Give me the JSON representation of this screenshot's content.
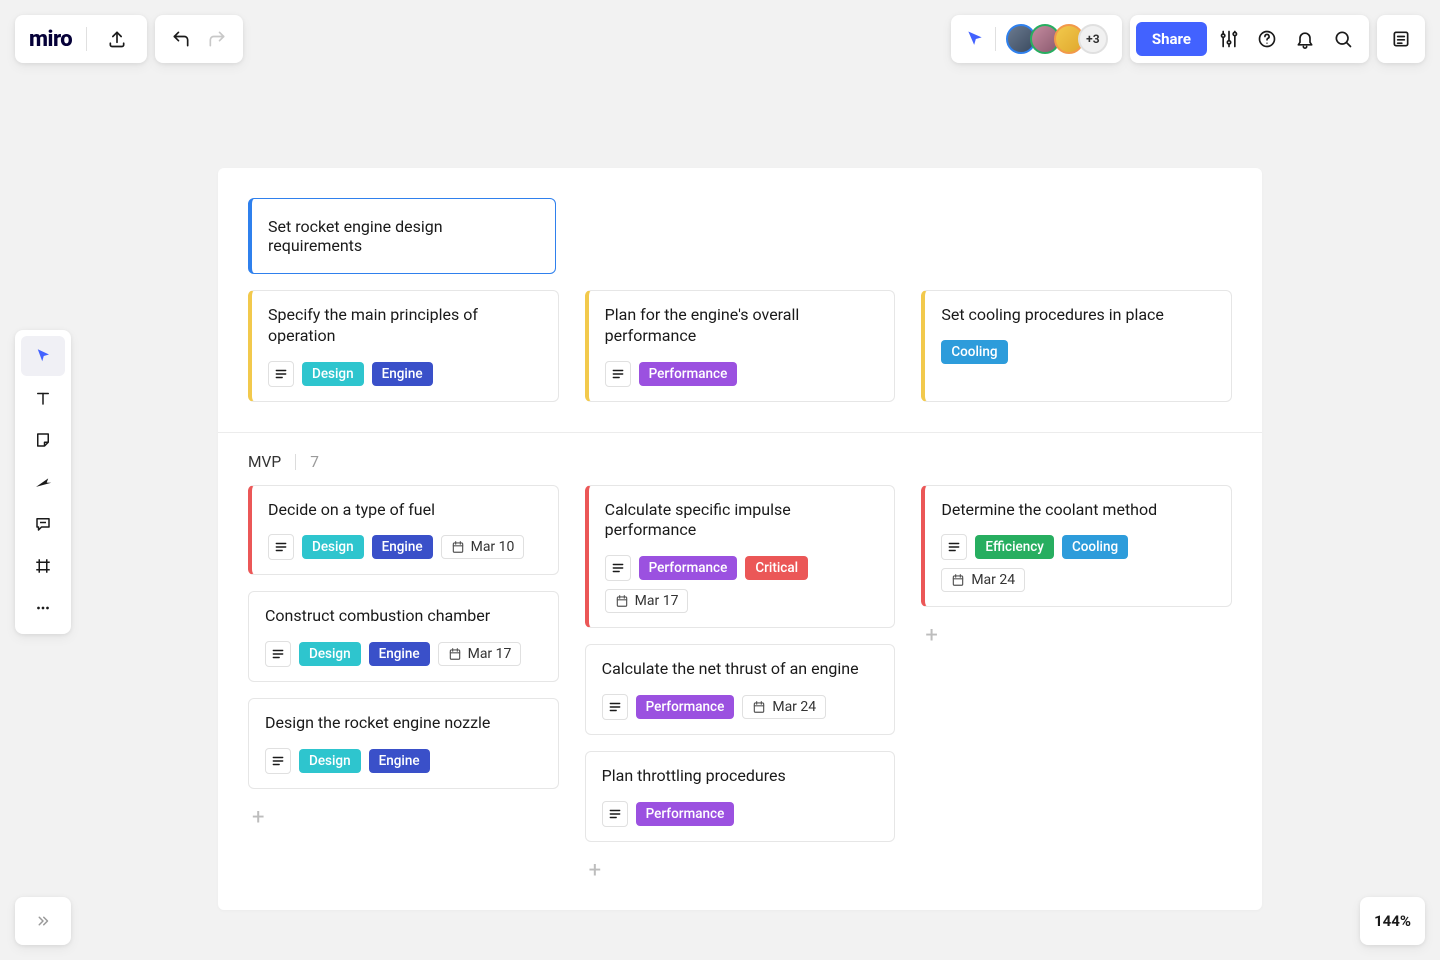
{
  "app": {
    "name": "miro"
  },
  "topbar": {
    "share_label": "Share",
    "more_avatars": "+3"
  },
  "zoom": "144%",
  "section_top": {
    "header_card": "Set rocket engine design requirements",
    "cards": [
      {
        "title": "Specify the main principles of operation",
        "tags": [
          "Design",
          "Engine"
        ],
        "has_desc": true
      },
      {
        "title": "Plan for the engine's overall performance",
        "tags": [
          "Performance"
        ],
        "has_desc": true
      },
      {
        "title": "Set cooling procedures in place",
        "tags": [
          "Cooling"
        ],
        "has_desc": false
      }
    ]
  },
  "section_mvp": {
    "label": "MVP",
    "count": "7",
    "columns": [
      [
        {
          "title": "Decide on a type of fuel",
          "accent": "red",
          "tags": [
            "Design",
            "Engine"
          ],
          "date": "Mar 10",
          "has_desc": true
        },
        {
          "title": "Construct combustion chamber",
          "accent": "none",
          "tags": [
            "Design",
            "Engine"
          ],
          "date": "Mar 17",
          "has_desc": true
        },
        {
          "title": "Design the rocket engine nozzle",
          "accent": "none",
          "tags": [
            "Design",
            "Engine"
          ],
          "has_desc": true
        }
      ],
      [
        {
          "title": "Calculate specific impulse performance",
          "accent": "red",
          "tags": [
            "Performance",
            "Critical"
          ],
          "date": "Mar 17",
          "has_desc": true
        },
        {
          "title": "Calculate the net thrust of an engine",
          "accent": "none",
          "tags": [
            "Performance"
          ],
          "date": "Mar 24",
          "has_desc": true
        },
        {
          "title": "Plan throttling procedures",
          "accent": "none",
          "tags": [
            "Performance"
          ],
          "has_desc": true
        }
      ],
      [
        {
          "title": "Determine the coolant method",
          "accent": "red",
          "tags": [
            "Efficiency",
            "Cooling"
          ],
          "date": "Mar 24",
          "has_desc": true
        }
      ]
    ]
  },
  "tag_colors": {
    "Design": "design",
    "Engine": "engine",
    "Performance": "performance",
    "Cooling": "cooling",
    "Critical": "critical",
    "Efficiency": "efficiency"
  }
}
